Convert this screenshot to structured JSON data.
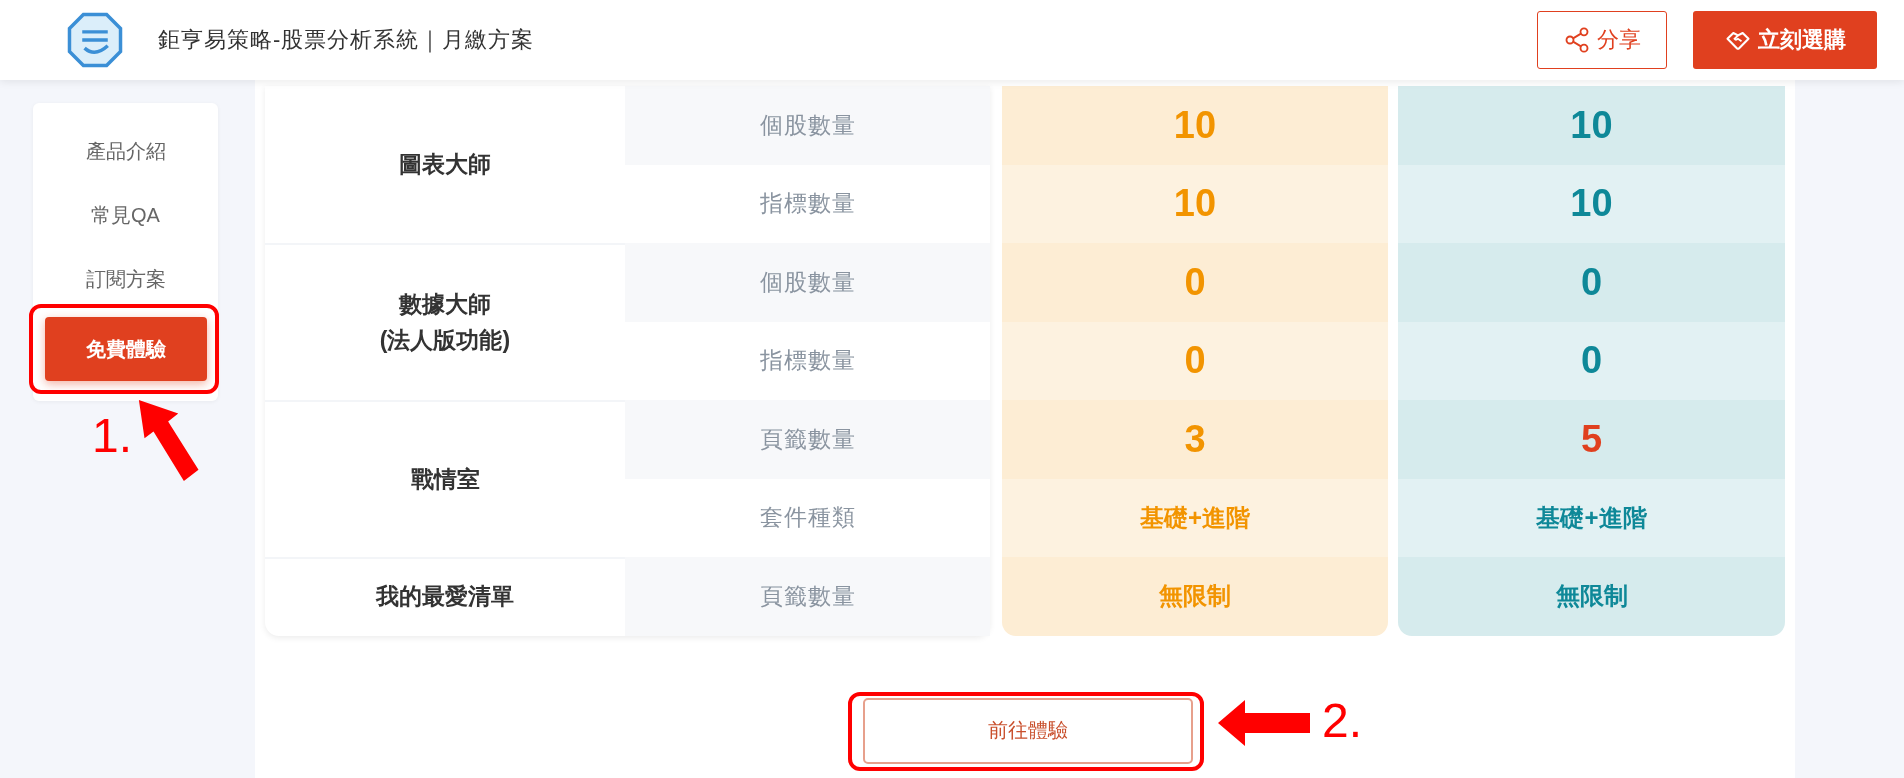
{
  "header": {
    "title": "鉅亨易策略-股票分析系統｜月繳方案",
    "share_button": "分享",
    "buy_button": "立刻選購"
  },
  "sidebar": {
    "items": [
      {
        "label": "產品介紹",
        "selected": false
      },
      {
        "label": "常見QA",
        "selected": false
      },
      {
        "label": "訂閱方案",
        "selected": false
      },
      {
        "label": "免費體驗",
        "selected": true
      }
    ]
  },
  "plans": [
    {
      "color": "#f29400"
    },
    {
      "color": "#0e8898"
    }
  ],
  "table": {
    "groups": [
      {
        "name": "圖表大師",
        "rows": [
          {
            "label": "個股數量",
            "values": [
              {
                "text": "10",
                "kind": "number",
                "emphasis": false
              },
              {
                "text": "10",
                "kind": "number",
                "emphasis": false
              }
            ]
          },
          {
            "label": "指標數量",
            "values": [
              {
                "text": "10",
                "kind": "number",
                "emphasis": false
              },
              {
                "text": "10",
                "kind": "number",
                "emphasis": false
              }
            ]
          }
        ]
      },
      {
        "name": "數據大師\n(法人版功能)",
        "rows": [
          {
            "label": "個股數量",
            "values": [
              {
                "text": "0",
                "kind": "number",
                "emphasis": false
              },
              {
                "text": "0",
                "kind": "number",
                "emphasis": false
              }
            ]
          },
          {
            "label": "指標數量",
            "values": [
              {
                "text": "0",
                "kind": "number",
                "emphasis": false
              },
              {
                "text": "0",
                "kind": "number",
                "emphasis": false
              }
            ]
          }
        ]
      },
      {
        "name": "戰情室",
        "rows": [
          {
            "label": "頁籤數量",
            "values": [
              {
                "text": "3",
                "kind": "number",
                "emphasis": false
              },
              {
                "text": "5",
                "kind": "number",
                "emphasis": true
              }
            ]
          },
          {
            "label": "套件種類",
            "values": [
              {
                "text": "基礎+進階",
                "kind": "text",
                "emphasis": false
              },
              {
                "text": "基礎+進階",
                "kind": "text",
                "emphasis": false
              }
            ]
          }
        ]
      },
      {
        "name": "我的最愛清單",
        "rows": [
          {
            "label": "頁籤數量",
            "values": [
              {
                "text": "無限制",
                "kind": "text",
                "emphasis": false
              },
              {
                "text": "無限制",
                "kind": "text",
                "emphasis": false
              }
            ]
          }
        ]
      }
    ]
  },
  "try_button": "前往體驗",
  "annotations": [
    {
      "label": "1."
    },
    {
      "label": "2."
    }
  ]
}
